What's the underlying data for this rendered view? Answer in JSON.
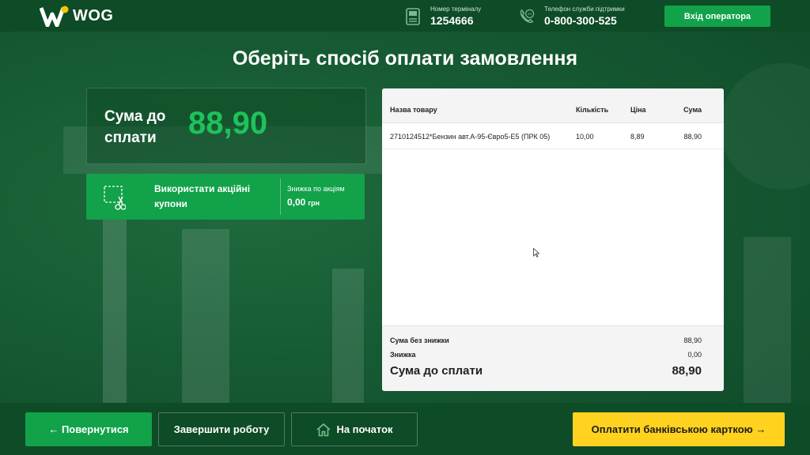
{
  "brand": {
    "name": "WOG",
    "colors": {
      "green": "#12a24a",
      "accent_green": "#1ec25b",
      "yellow": "#ffd21f",
      "dark_green": "#0e4b27",
      "logo_yellow": "#f5c400"
    }
  },
  "header": {
    "terminal_label": "Номер терміналу",
    "terminal_number": "1254666",
    "support_label": "Телефон служби підтримки",
    "support_phone": "0-800-300-525",
    "operator_button": "Вхід оператора",
    "terminal_icon": "terminal-icon",
    "phone_icon": "phone-24-icon"
  },
  "page": {
    "title": "Оберіть спосіб оплати замовлення"
  },
  "sum_panel": {
    "label": "Сума до сплати",
    "value": "88,90"
  },
  "coupon": {
    "label": "Використати акційні купони",
    "icon": "scissors-coupon-icon",
    "discount_title": "Знижка по акціям",
    "discount_value": "0,00",
    "discount_unit": "грн"
  },
  "receipt": {
    "columns": {
      "name": "Назва товару",
      "qty": "Кількість",
      "price": "Ціна",
      "sum": "Сума"
    },
    "rows": [
      {
        "name": "2710124512*Бензин авт.А-95-Євро5-Е5 (ПРК 05)",
        "qty": "10,00",
        "price": "8,89",
        "sum": "88,90"
      }
    ],
    "footer": {
      "subtotal_label": "Сума без знижки",
      "subtotal_value": "88,90",
      "discount_label": "Знижка",
      "discount_value": "0,00",
      "total_label": "Сума до сплати",
      "total_value": "88,90"
    }
  },
  "footer": {
    "back": "← Повернутися",
    "finish": "Завершити роботу",
    "home": "На початок",
    "pay": "Оплатити банківською карткою →",
    "home_icon": "home-icon"
  }
}
